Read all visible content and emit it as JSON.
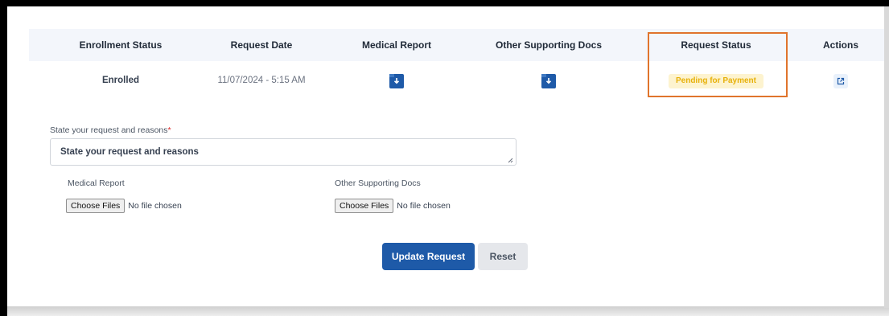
{
  "table": {
    "headers": [
      "Enrollment Status",
      "Request Date",
      "Medical Report",
      "Other Supporting Docs",
      "Request Status",
      "Actions"
    ],
    "row": {
      "enrollment_status": "Enrolled",
      "request_date": "11/07/2024 - 5:15 AM",
      "medical_report_icon": "download-icon",
      "supporting_docs_icon": "download-icon",
      "request_status": "Pending for Payment",
      "action_icon": "external-link-icon"
    }
  },
  "form": {
    "reason_label": "State your request and reasons",
    "reason_required_mark": "*",
    "reason_value": "State your request and reasons",
    "medical_report_label": "Medical Report",
    "supporting_docs_label": "Other Supporting Docs",
    "choose_files_label": "Choose Files",
    "no_file_text": "No file chosen",
    "update_button": "Update Request",
    "reset_button": "Reset"
  },
  "colors": {
    "primary": "#1e5aa8",
    "status_badge_bg": "#fdf3cf",
    "status_badge_text": "#e7b10a",
    "highlight_border": "#e0742c",
    "required": "#dc2626"
  }
}
